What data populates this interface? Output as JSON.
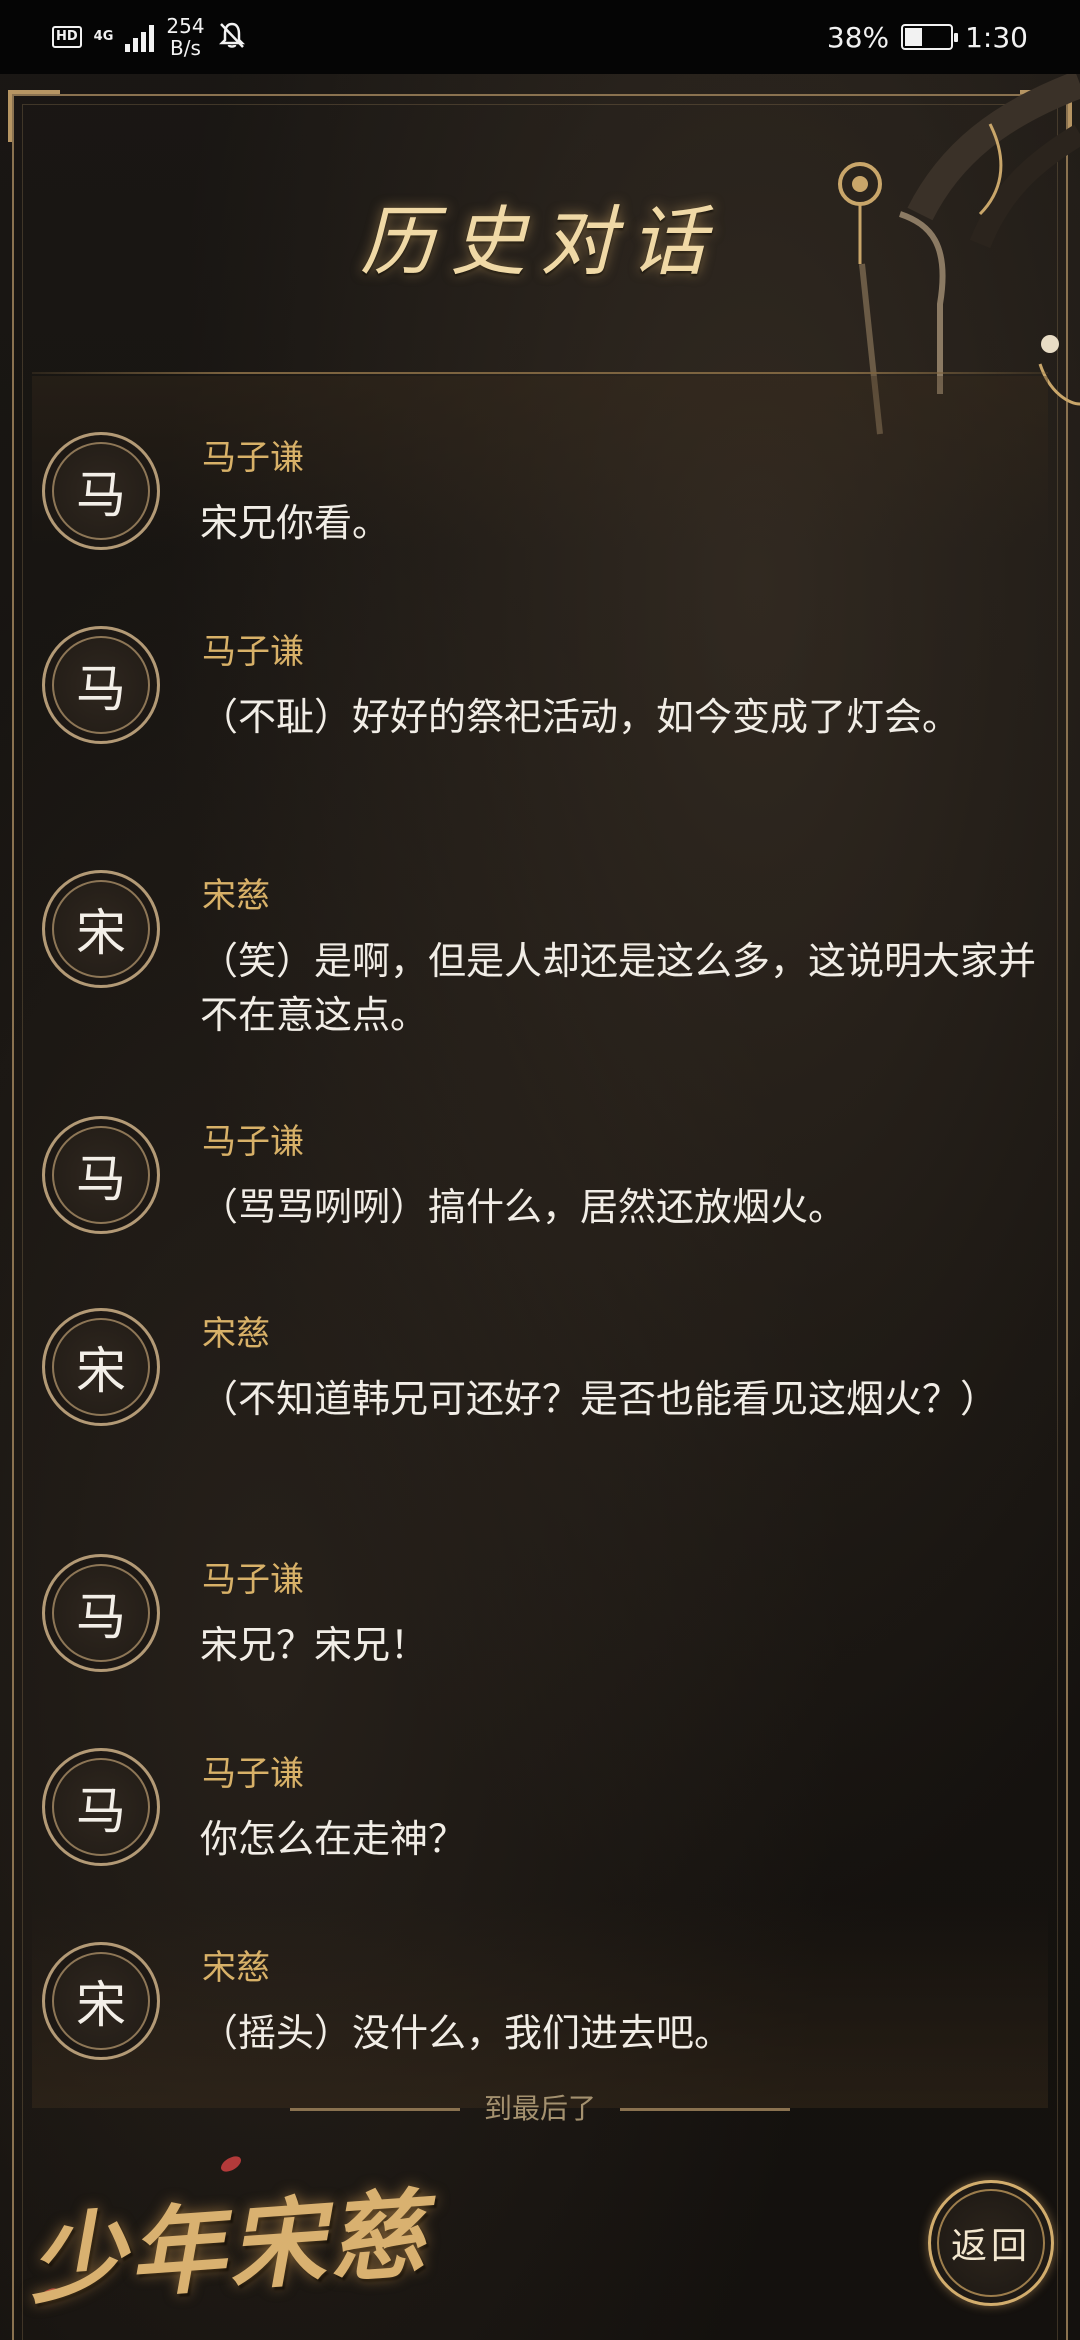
{
  "status_bar": {
    "hd": "HD",
    "network": "4G",
    "speed_value": "254",
    "speed_unit": "B/s",
    "battery_percent": "38%",
    "battery_level": 0.38,
    "time": "1:30",
    "icons": [
      "hd-icon",
      "signal-icon",
      "bell-off-icon",
      "battery-charging-icon"
    ]
  },
  "page": {
    "title": "历史对话",
    "end_text": "到最后了",
    "logo": "少年宋慈",
    "return_label": "返回"
  },
  "dialogue": [
    {
      "avatar": "马",
      "speaker": "马子谦",
      "text": "宋兄你看。"
    },
    {
      "avatar": "马",
      "speaker": "马子谦",
      "text": "（不耻）好好的祭祀活动，如今变成了灯会。"
    },
    {
      "avatar": "宋",
      "speaker": "宋慈",
      "text": "（笑）是啊，但是人却还是这么多，这说明大家并不在意这点。"
    },
    {
      "avatar": "马",
      "speaker": "马子谦",
      "text": "（骂骂咧咧）搞什么，居然还放烟火。"
    },
    {
      "avatar": "宋",
      "speaker": "宋慈",
      "text": "（不知道韩兄可还好？是否也能看见这烟火？）"
    },
    {
      "avatar": "马",
      "speaker": "马子谦",
      "text": "宋兄？宋兄！"
    },
    {
      "avatar": "马",
      "speaker": "马子谦",
      "text": "你怎么在走神？"
    },
    {
      "avatar": "宋",
      "speaker": "宋慈",
      "text": "（摇头）没什么，我们进去吧。"
    }
  ],
  "colors": {
    "accent_gold": "#d8b168",
    "text": "#f1ede6",
    "background": "#14110e"
  }
}
